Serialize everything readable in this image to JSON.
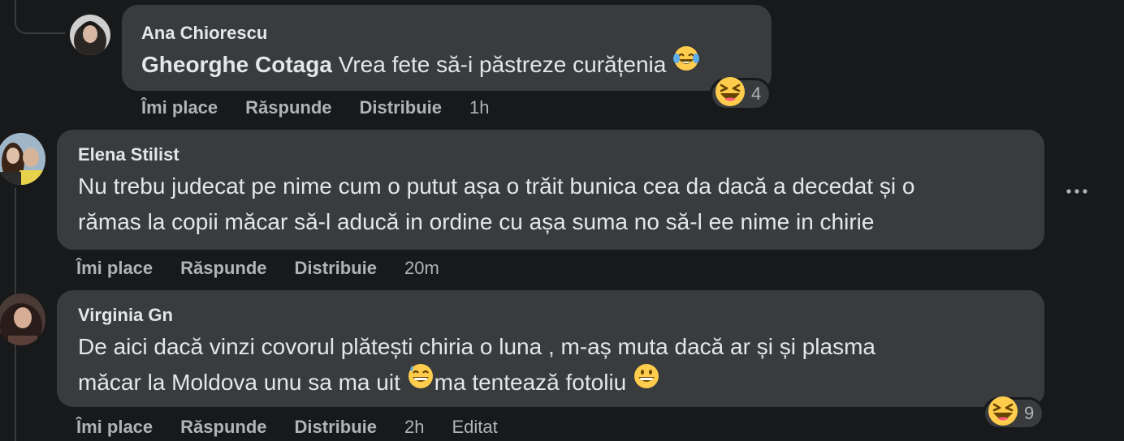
{
  "comments": [
    {
      "author": "Ana Chiorescu",
      "mention": "Gheorghe Cotaga",
      "text": " Vrea fete să-i păstreze curățenia ",
      "text_emoji": "face-with-tears-of-joy",
      "actions": {
        "like": "Îmi place",
        "reply": "Răspunde",
        "share": "Distribuie",
        "time": "1h"
      },
      "reaction": {
        "emoji": "laughing-face",
        "count": "4"
      }
    },
    {
      "author": "Elena Stilist",
      "line1": "Nu trebu judecat pe nime cum o putut așa o trăit bunica cea da dacă a decedat și o",
      "line2": "rămas la copii măcar să-l aducă in ordine cu așa suma no să-l ee nime in chirie",
      "actions": {
        "like": "Îmi place",
        "reply": "Răspunde",
        "share": "Distribuie",
        "time": "20m"
      }
    },
    {
      "author": "Virginia Gn",
      "line1": "De aici dacă vinzi covorul plătești chiria o luna , m-aș muta dacă ar și și plasma",
      "line2a": "măcar la Moldova unu sa ma uit ",
      "line2b": "ma tentează fotoliu ",
      "emojis": [
        "grinning-face-with-sweat",
        "grinning-face"
      ],
      "actions": {
        "like": "Îmi place",
        "reply": "Răspunde",
        "share": "Distribuie",
        "time": "2h",
        "edited": "Editat"
      },
      "reaction": {
        "emoji": "laughing-face",
        "count": "9"
      }
    }
  ],
  "colors": {
    "background": "#18191a",
    "bubble": "#3a3b3c",
    "primary_text": "#e4e6eb",
    "secondary_text": "#b0b3b8",
    "emoji_yellow": "#ffcc4d"
  },
  "icons": {
    "more": "more-options-icon"
  }
}
